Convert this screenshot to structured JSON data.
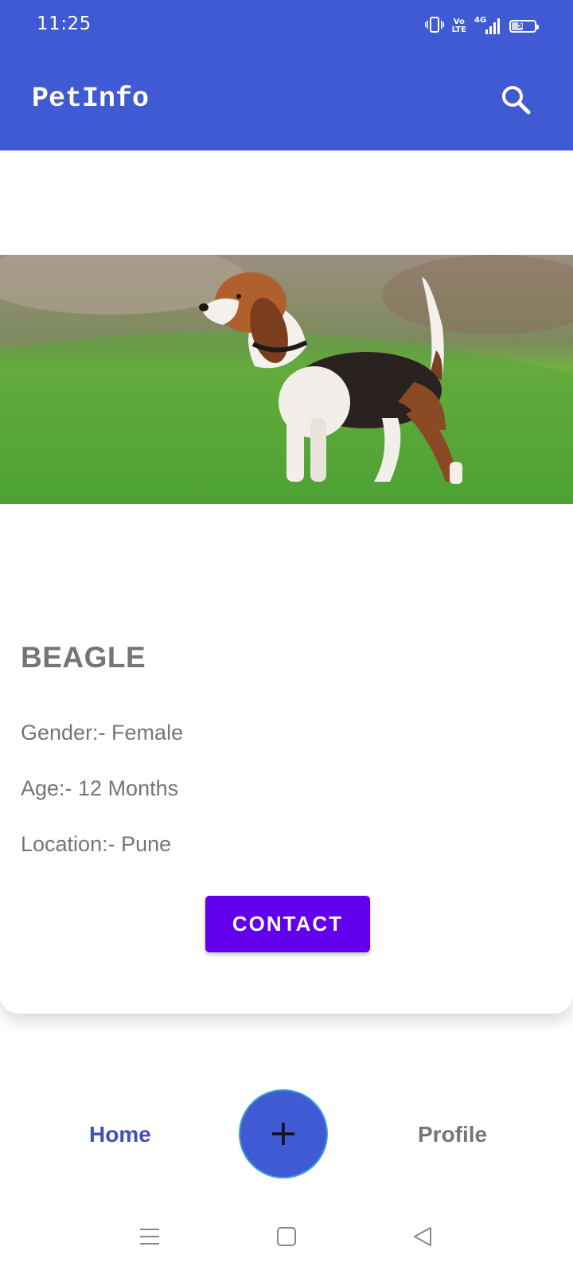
{
  "status_bar": {
    "time": "11:25",
    "indicators": [
      "vibrate-icon",
      "volte-icon",
      "4g-signal-icon"
    ],
    "volte_top": "Vo",
    "volte_bottom": "LTE",
    "network": "4G",
    "battery": "51",
    "battery_level": 0.51
  },
  "app_bar": {
    "title": "PetInfo",
    "search_icon": "search-icon",
    "color": "#405AD4"
  },
  "pet": {
    "image_alt": "beagle-photo",
    "breed": "BEAGLE",
    "gender": "Gender:- Female",
    "age": "Age:- 12 Months",
    "location": "Location:- Pune",
    "contact_label": "CONTACT",
    "contact_color": "#6200EE"
  },
  "bottom_nav": {
    "home_label": "Home",
    "profile_label": "Profile",
    "fab_icon": "plus-icon",
    "active": "Home",
    "active_color": "#3F51B5"
  },
  "system_nav": {
    "icons": [
      "menu-icon",
      "home-square-icon",
      "back-triangle-icon"
    ]
  }
}
